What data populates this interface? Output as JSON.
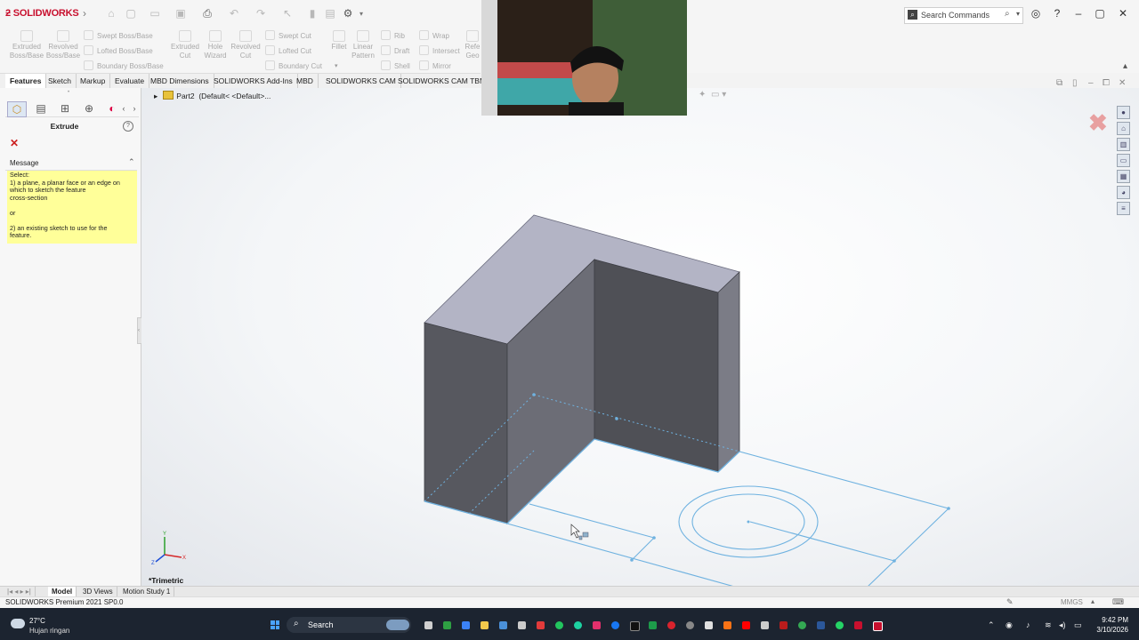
{
  "app": {
    "logo": "SOLIDWORKS",
    "search_placeholder": "Search Commands"
  },
  "command_manager": {
    "big_buttons": [
      {
        "label": "Extruded\nBoss/Base",
        "line1": "Extruded",
        "line2": "Boss/Base"
      },
      {
        "label": "Revolved\nBoss/Base",
        "line1": "Revolved",
        "line2": "Boss/Base"
      },
      {
        "label": "Extruded\nCut",
        "line1": "Extruded",
        "line2": "Cut"
      },
      {
        "label": "Hole\nWizard",
        "line1": "Hole",
        "line2": "Wizard"
      },
      {
        "label": "Revolved\nCut",
        "line1": "Revolved",
        "line2": "Cut"
      },
      {
        "label": "Fillet",
        "line1": "Fillet",
        "line2": ""
      },
      {
        "label": "Linear\nPattern",
        "line1": "Linear",
        "line2": "Pattern"
      },
      {
        "label": "Refe\nGeo",
        "line1": "Refe",
        "line2": "Geo"
      }
    ],
    "small_buttons": {
      "swept_boss": "Swept Boss/Base",
      "lofted_boss": "Lofted Boss/Base",
      "boundary_boss": "Boundary Boss/Base",
      "swept_cut": "Swept Cut",
      "lofted_cut": "Lofted Cut",
      "boundary_cut": "Boundary Cut",
      "rib": "Rib",
      "draft": "Draft",
      "shell": "Shell",
      "wrap": "Wrap",
      "intersect": "Intersect",
      "mirror": "Mirror"
    }
  },
  "tabs": [
    {
      "label": "Features",
      "active": true
    },
    {
      "label": "Sketch"
    },
    {
      "label": "Markup"
    },
    {
      "label": "Evaluate"
    },
    {
      "label": "MBD Dimensions"
    },
    {
      "label": "SOLIDWORKS Add-Ins"
    },
    {
      "label": "MBD"
    },
    {
      "label": "SOLIDWORKS CAM"
    },
    {
      "label": "SOLIDWORKS CAM TBM"
    }
  ],
  "property_manager": {
    "title": "Extrude",
    "message_header": "Message",
    "message_lines": [
      "Select:",
      "1) a plane, a planar face or an edge on",
      "which to sketch the feature",
      "cross-section",
      "",
      "or",
      "",
      "2) an existing sketch to use for the",
      "feature."
    ]
  },
  "feature_tree": {
    "part_name": "Part2",
    "config": "(Default< <Default>..."
  },
  "graphics": {
    "view_orientation": "*Trimetric",
    "triad": {
      "x": "X",
      "y": "Y",
      "z": "Z"
    }
  },
  "bottom_tabs": [
    {
      "label": "Model",
      "active": true
    },
    {
      "label": "3D Views"
    },
    {
      "label": "Motion Study 1"
    }
  ],
  "status": {
    "product": "SOLIDWORKS Premium 2021 SP0.0",
    "units": "MMGS"
  },
  "taskbar": {
    "weather_temp": "27°C",
    "weather_desc": "Hujan ringan",
    "search_label": "Search",
    "time": "9:42 PM",
    "date": "3/10/2026"
  },
  "colors": {
    "accent_red": "#c8102e",
    "sketch_blue": "#6fb2e0",
    "message_yellow": "#ffff99"
  }
}
